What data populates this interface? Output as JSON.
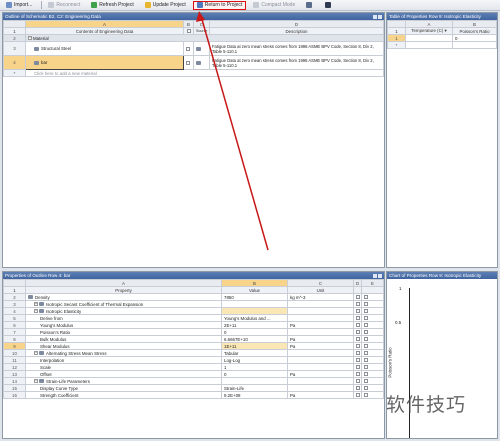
{
  "toolbar": {
    "items": [
      {
        "label": "Import...",
        "icon": "import-icon",
        "disabled": false
      },
      {
        "label": "Reconnect",
        "icon": "reconnect-icon",
        "disabled": true
      },
      {
        "label": "Refresh Project",
        "icon": "refresh-icon",
        "disabled": false
      },
      {
        "label": "Update Project",
        "icon": "update-icon",
        "disabled": false
      },
      {
        "label": "Return to Project",
        "icon": "return-icon",
        "disabled": false
      },
      {
        "label": "Compact Mode",
        "icon": "compact-icon",
        "disabled": true
      }
    ]
  },
  "outline": {
    "title": "Outline of Schematic B2, C2: Engineering Data",
    "col_letters": [
      "A",
      "B",
      "C",
      "D"
    ],
    "headers": {
      "contents": "Contents of Engineering Data",
      "source": "Source",
      "description": "Description"
    },
    "category": "Material",
    "rows": [
      {
        "num": "1"
      },
      {
        "num": "2"
      },
      {
        "num": "3",
        "name": "Structural Steel",
        "description": "Fatigue Data at zero mean stress comes from 1998 ASME BPV Code, Section 8, Div 2, Table 5-110.1"
      },
      {
        "num": "4",
        "name": "bar",
        "description": "Fatigue Data at zero mean stress comes from 1998 ASME BPV Code, Section 8, Div 2, Table 5-110.1"
      },
      {
        "num": "*",
        "name": "Click here to add a new material"
      }
    ]
  },
  "table_props": {
    "title": "Table of Properties Row 9: Isotropic Elasticity",
    "col_letters": [
      "A",
      "B"
    ],
    "headers": [
      "Temperature (C)",
      "Poisson's Ratio"
    ],
    "rows": [
      {
        "num": "1",
        "a": "",
        "b": "0"
      },
      {
        "num": "*",
        "a": "",
        "b": ""
      }
    ]
  },
  "properties": {
    "title": "Properties of Outline Row 4: bar",
    "col_letters": [
      "A",
      "B",
      "C",
      "D",
      "E"
    ],
    "headers": {
      "property": "Property",
      "value": "Value",
      "unit": "Unit"
    },
    "rows": [
      {
        "num": "1",
        "property": "",
        "value": "",
        "unit": ""
      },
      {
        "num": "2",
        "property": "Density",
        "value": "7850",
        "unit": "kg m^-3"
      },
      {
        "num": "3",
        "property": "Isotropic Secant Coefficient of Thermal Expansion",
        "value": "",
        "unit": ""
      },
      {
        "num": "4",
        "property": "Isotropic Elasticity",
        "value": "",
        "unit": ""
      },
      {
        "num": "5",
        "property": "Derive from",
        "value": "Young's Modulus and ...",
        "unit": ""
      },
      {
        "num": "6",
        "property": "Young's Modulus",
        "value": "2E+11",
        "unit": "Pa"
      },
      {
        "num": "7",
        "property": "Poisson's Ratio",
        "value": "0",
        "unit": ""
      },
      {
        "num": "8",
        "property": "Bulk Modulus",
        "value": "6.6667E+10",
        "unit": "Pa"
      },
      {
        "num": "9",
        "property": "Shear Modulus",
        "value": "1E+11",
        "unit": "Pa"
      },
      {
        "num": "10",
        "property": "Alternating Stress Mean Stress",
        "value": "Tabular",
        "unit": ""
      },
      {
        "num": "11",
        "property": "Interpolation",
        "value": "Log-Log",
        "unit": ""
      },
      {
        "num": "12",
        "property": "Scale",
        "value": "1",
        "unit": ""
      },
      {
        "num": "13",
        "property": "Offset",
        "value": "0",
        "unit": "Pa"
      },
      {
        "num": "14",
        "property": "Strain-Life Parameters",
        "value": "",
        "unit": ""
      },
      {
        "num": "15",
        "property": "Display Curve Type",
        "value": "Strain-Life",
        "unit": ""
      },
      {
        "num": "16",
        "property": "Strength Coefficient",
        "value": "9.2E+08",
        "unit": "Pa"
      }
    ]
  },
  "chart": {
    "title": "Chart of Properties Row 9: Isotropic Elasticity",
    "y_ticks": [
      "1",
      "0.5"
    ],
    "y_label": "Poisson's Ratio"
  },
  "watermark": "软件技巧"
}
